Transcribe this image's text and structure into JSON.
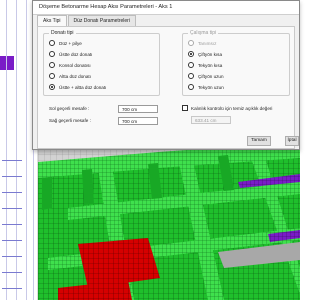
{
  "dialog": {
    "title": "Döşeme Betonarme Hesap Aksı Parametreleri - Aks 1",
    "tabs": [
      {
        "label": "Aks Tipi",
        "active": true
      },
      {
        "label": "Düz Donatı Parametreleri",
        "active": false
      }
    ],
    "rebar_type": {
      "title": "Donatı tipi",
      "options": [
        {
          "label": "Düz + pilye",
          "checked": false
        },
        {
          "label": "Üstte düz donatı",
          "checked": false
        },
        {
          "label": "Konsol donatısı",
          "checked": false
        },
        {
          "label": "Altta düz donatı",
          "checked": false
        },
        {
          "label": "Üstte + altta düz donatı",
          "checked": true
        }
      ]
    },
    "work_type": {
      "title": "Çalışma tipi",
      "options": [
        {
          "label": "Tanımsız",
          "checked": false,
          "enabled": false
        },
        {
          "label": "Çiftyön kısa",
          "checked": true,
          "enabled": true
        },
        {
          "label": "Tekyön kısa",
          "checked": false,
          "enabled": true
        },
        {
          "label": "Çiftyön uzun",
          "checked": false,
          "enabled": true
        },
        {
          "label": "Tekyön uzun",
          "checked": false,
          "enabled": true
        }
      ]
    },
    "distances": {
      "left_label": "Sol geçerli mesafe :",
      "left_value": "700 cm",
      "right_label": "Sağ geçerli mesafe :",
      "right_value": "700 cm"
    },
    "thickness_check": {
      "label": "Kalınlık kontrolü için temiz açıklık değeri",
      "checked": false,
      "value": "633.41 cm"
    },
    "buttons": {
      "ok": "Tamam",
      "cancel": "İptal"
    }
  },
  "colors": {
    "slab_green": "#1fbf2c",
    "beam_green": "#3fe04d",
    "column_green": "#18a825",
    "red_region": "#d60000",
    "purple_beam": "#7a1cc7"
  }
}
